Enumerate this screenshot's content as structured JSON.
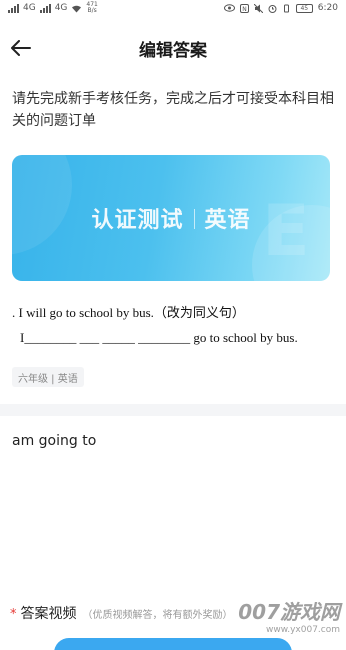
{
  "status_bar": {
    "network_left": "4G",
    "network_right": "4G",
    "speed_value": "471",
    "speed_unit": "B/s",
    "battery": "45",
    "time": "6:20"
  },
  "header": {
    "title": "编辑答案"
  },
  "notice": {
    "text": "请先完成新手考核任务，完成之后才可接受本科目相关的问题订单"
  },
  "banner": {
    "left": "认证测试",
    "right": "英语"
  },
  "question": {
    "line1": ". I will go to school by bus.（改为同义句）",
    "line2": "I________ ___ _____ ________ go to school by bus."
  },
  "tag": {
    "label": "六年级 | 英语"
  },
  "answer": {
    "text": "am going to"
  },
  "video_section": {
    "required_mark": "*",
    "title": "答案视频",
    "hint": "（优质视频解答，将有额外奖励）"
  },
  "watermark": {
    "main": "007游戏网",
    "sub": "www.yx007.com"
  },
  "colors": {
    "accent": "#3ba8f0",
    "banner_start": "#37b3ea",
    "banner_end": "#a6e8f8",
    "required": "#e53935"
  }
}
